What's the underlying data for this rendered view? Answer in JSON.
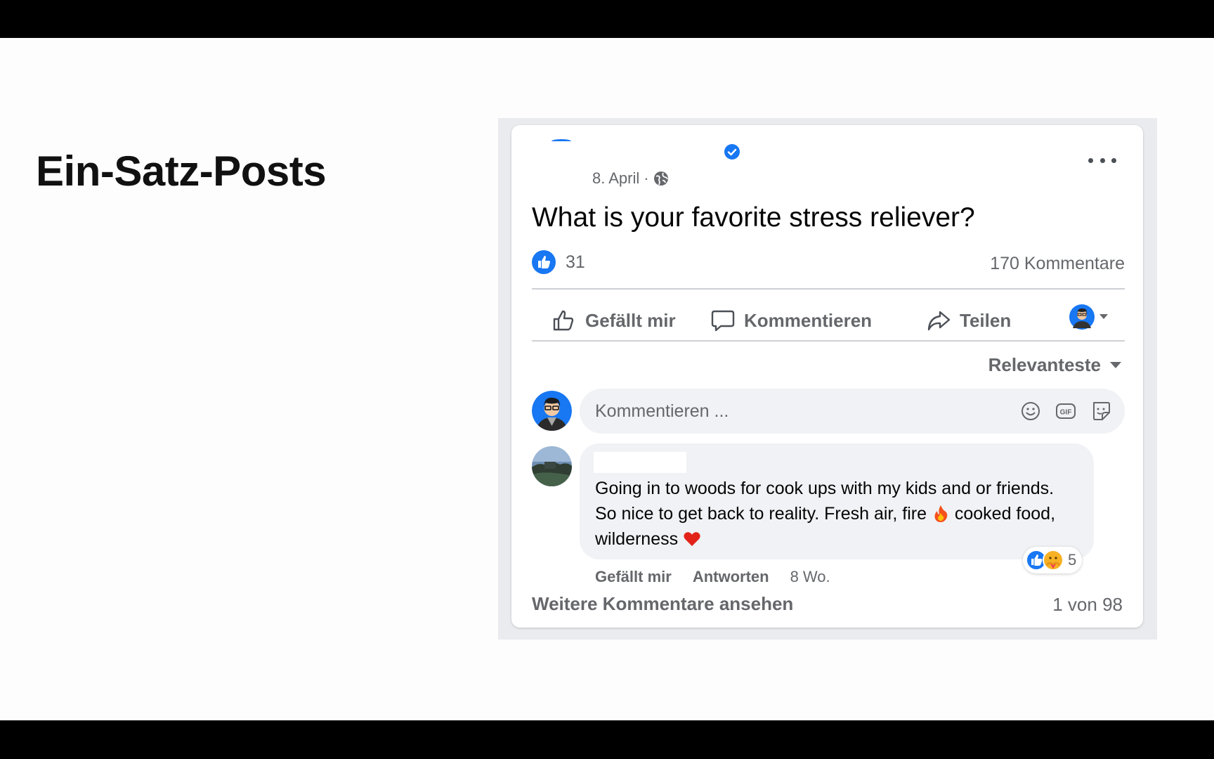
{
  "slide": {
    "title": "Ein-Satz-Posts"
  },
  "post": {
    "date": "8. April",
    "separator": "·",
    "text": "What is your favorite stress reliever?",
    "like_count": "31",
    "comment_count": "170 Kommentare",
    "actions": {
      "like": "Gefällt mir",
      "comment": "Kommentieren",
      "share": "Teilen"
    },
    "sort_label": "Relevanteste",
    "composer_placeholder": "Kommentieren ...",
    "comment": {
      "text_1": "Going in to woods for cook ups with my kids and or friends. So nice to get back to reality. Fresh air, fire ",
      "text_2": " cooked food, wilderness ",
      "reaction_count": "5",
      "like_action": "Gefällt mir",
      "reply_action": "Antworten",
      "time": "8 Wo."
    },
    "view_more": "Weitere Kommentare ansehen",
    "paging": "1 von 98"
  },
  "colors": {
    "brand_blue": "#1877f2",
    "secondary_text": "#65676b",
    "bubble_bg": "#f0f2f5",
    "divider": "#ced0d4"
  },
  "icons": [
    "verified-icon",
    "globe-icon",
    "more-icon",
    "like-reaction-icon",
    "thumbs-up-icon",
    "comment-icon",
    "share-icon",
    "avatar",
    "caret-down-icon",
    "emoji-icon",
    "gif-icon",
    "sticker-icon",
    "fire-emoji",
    "heart-emoji",
    "care-reaction-icon"
  ]
}
